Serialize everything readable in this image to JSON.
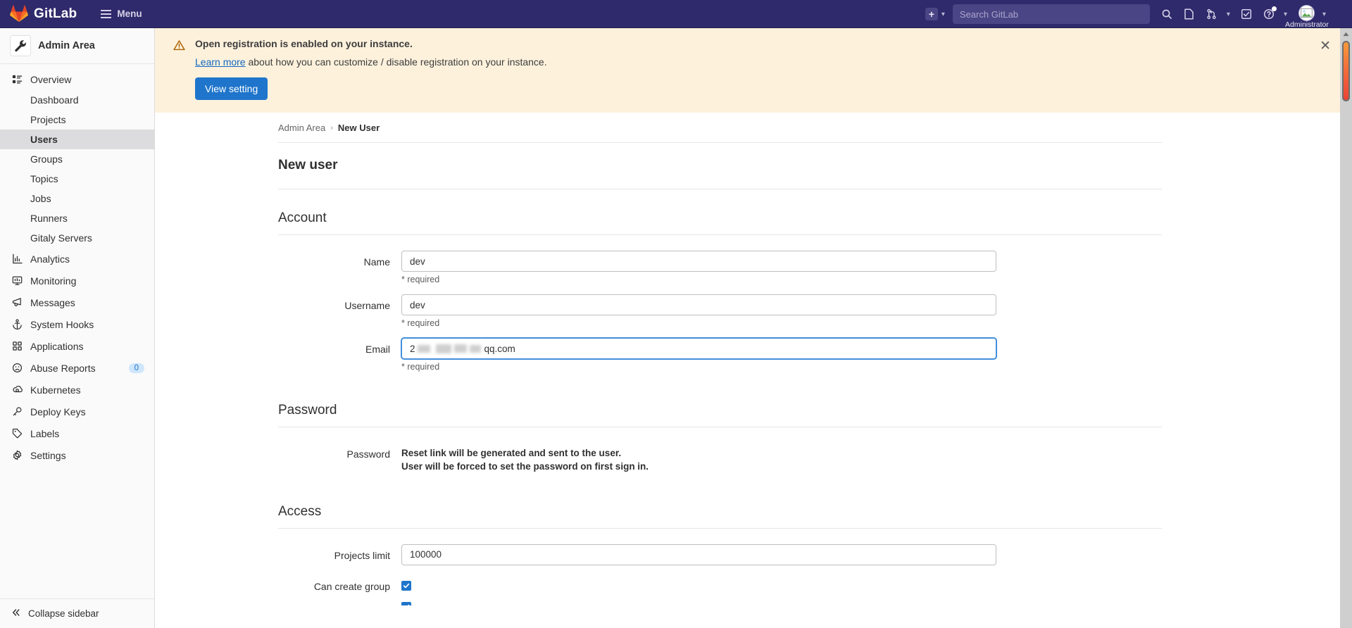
{
  "navbar": {
    "brand": "GitLab",
    "menu_label": "Menu",
    "create_new_label": "+",
    "search_placeholder": "Search GitLab",
    "search_value": "",
    "icons": [
      "search-icon",
      "issues-icon",
      "merge-requests-icon",
      "todos-icon",
      "help-icon"
    ],
    "user_name": "Administrator"
  },
  "sidebar": {
    "context_label": "Admin Area",
    "context_icon": "wrench-icon",
    "overview": {
      "label": "Overview",
      "icon": "overview-icon",
      "children": [
        {
          "label": "Dashboard",
          "active": false
        },
        {
          "label": "Projects",
          "active": false
        },
        {
          "label": "Users",
          "active": true
        },
        {
          "label": "Groups",
          "active": false
        },
        {
          "label": "Topics",
          "active": false
        },
        {
          "label": "Jobs",
          "active": false
        },
        {
          "label": "Runners",
          "active": false
        },
        {
          "label": "Gitaly Servers",
          "active": false
        }
      ]
    },
    "items": [
      {
        "label": "Analytics",
        "icon": "chart-icon",
        "badge": null
      },
      {
        "label": "Monitoring",
        "icon": "monitor-icon",
        "badge": null
      },
      {
        "label": "Messages",
        "icon": "megaphone-icon",
        "badge": null
      },
      {
        "label": "System Hooks",
        "icon": "anchor-icon",
        "badge": null
      },
      {
        "label": "Applications",
        "icon": "grid-icon",
        "badge": null
      },
      {
        "label": "Abuse Reports",
        "icon": "sad-face-icon",
        "badge": "0"
      },
      {
        "label": "Kubernetes",
        "icon": "kubernetes-icon",
        "badge": null
      },
      {
        "label": "Deploy Keys",
        "icon": "key-icon",
        "badge": null
      },
      {
        "label": "Labels",
        "icon": "label-icon",
        "badge": null
      },
      {
        "label": "Settings",
        "icon": "gear-icon",
        "badge": null
      }
    ],
    "collapse_label": "Collapse sidebar",
    "collapse_icon": "double-chevron-left-icon"
  },
  "alert": {
    "icon": "warning-triangle-icon",
    "title": "Open registration is enabled on your instance.",
    "link_text": "Learn more",
    "description_rest": " about how you can customize / disable registration on your instance.",
    "button_label": "View setting",
    "close_label": "✕"
  },
  "breadcrumb": {
    "root": "Admin Area",
    "separator": "›",
    "current": "New User"
  },
  "page": {
    "title": "New user"
  },
  "sections": {
    "account": {
      "heading": "Account",
      "fields": [
        {
          "label": "Name",
          "value": "dev",
          "hint": "* required",
          "focused": false
        },
        {
          "label": "Username",
          "value": "dev",
          "hint": "* required",
          "focused": false
        }
      ],
      "email": {
        "label": "Email",
        "value_visible_suffix": "qq.com",
        "value_prefix_char": "2",
        "hint": "* required",
        "focused": true,
        "redacted": true
      }
    },
    "password": {
      "heading": "Password",
      "label": "Password",
      "line1": "Reset link will be generated and sent to the user.",
      "line2": "User will be forced to set the password on first sign in."
    },
    "access": {
      "heading": "Access",
      "projects_limit": {
        "label": "Projects limit",
        "value": "100000"
      },
      "can_create_group": {
        "label": "Can create group",
        "checked": true
      }
    }
  },
  "colors": {
    "nav_bg": "#2f2a6b",
    "accent_blue": "#1f75cb",
    "alert_bg": "#fdf1dc",
    "sidebar_bg": "#fafafa",
    "active_item_bg": "#dcdcde",
    "link_blue": "#1068bf"
  }
}
